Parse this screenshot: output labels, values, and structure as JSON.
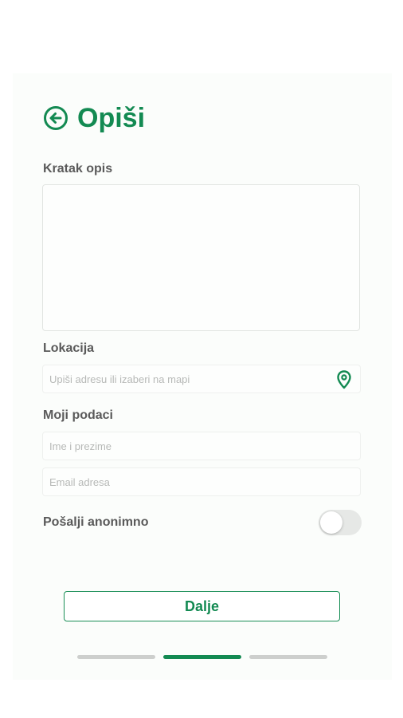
{
  "header": {
    "title": "Opiši",
    "back_icon": "arrow-left-circle-icon"
  },
  "description": {
    "label": "Kratak opis",
    "value": ""
  },
  "location": {
    "label": "Lokacija",
    "placeholder": "Upiši adresu ili izaberi na mapi",
    "value": "",
    "icon": "map-pin-icon"
  },
  "personal": {
    "label": "Moji podaci",
    "name_placeholder": "Ime i prezime",
    "email_placeholder": "Email adresa"
  },
  "anonymous": {
    "label": "Pošalji anonimno",
    "enabled": false
  },
  "actions": {
    "next_label": "Dalje"
  },
  "progress": {
    "total_steps": 3,
    "current_step": 2
  },
  "colors": {
    "accent": "#138a52",
    "label": "#5a5a5a",
    "inactive_step": "#cdcfcd"
  }
}
